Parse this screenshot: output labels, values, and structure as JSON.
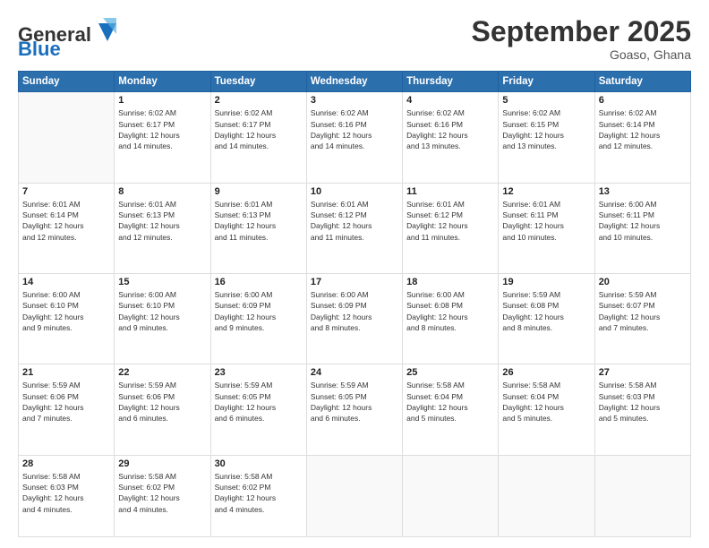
{
  "header": {
    "logo_general": "General",
    "logo_blue": "Blue",
    "month_title": "September 2025",
    "subtitle": "Goaso, Ghana"
  },
  "days_of_week": [
    "Sunday",
    "Monday",
    "Tuesday",
    "Wednesday",
    "Thursday",
    "Friday",
    "Saturday"
  ],
  "weeks": [
    [
      {
        "day": "",
        "info": ""
      },
      {
        "day": "1",
        "info": "Sunrise: 6:02 AM\nSunset: 6:17 PM\nDaylight: 12 hours\nand 14 minutes."
      },
      {
        "day": "2",
        "info": "Sunrise: 6:02 AM\nSunset: 6:17 PM\nDaylight: 12 hours\nand 14 minutes."
      },
      {
        "day": "3",
        "info": "Sunrise: 6:02 AM\nSunset: 6:16 PM\nDaylight: 12 hours\nand 14 minutes."
      },
      {
        "day": "4",
        "info": "Sunrise: 6:02 AM\nSunset: 6:16 PM\nDaylight: 12 hours\nand 13 minutes."
      },
      {
        "day": "5",
        "info": "Sunrise: 6:02 AM\nSunset: 6:15 PM\nDaylight: 12 hours\nand 13 minutes."
      },
      {
        "day": "6",
        "info": "Sunrise: 6:02 AM\nSunset: 6:14 PM\nDaylight: 12 hours\nand 12 minutes."
      }
    ],
    [
      {
        "day": "7",
        "info": "Sunrise: 6:01 AM\nSunset: 6:14 PM\nDaylight: 12 hours\nand 12 minutes."
      },
      {
        "day": "8",
        "info": "Sunrise: 6:01 AM\nSunset: 6:13 PM\nDaylight: 12 hours\nand 12 minutes."
      },
      {
        "day": "9",
        "info": "Sunrise: 6:01 AM\nSunset: 6:13 PM\nDaylight: 12 hours\nand 11 minutes."
      },
      {
        "day": "10",
        "info": "Sunrise: 6:01 AM\nSunset: 6:12 PM\nDaylight: 12 hours\nand 11 minutes."
      },
      {
        "day": "11",
        "info": "Sunrise: 6:01 AM\nSunset: 6:12 PM\nDaylight: 12 hours\nand 11 minutes."
      },
      {
        "day": "12",
        "info": "Sunrise: 6:01 AM\nSunset: 6:11 PM\nDaylight: 12 hours\nand 10 minutes."
      },
      {
        "day": "13",
        "info": "Sunrise: 6:00 AM\nSunset: 6:11 PM\nDaylight: 12 hours\nand 10 minutes."
      }
    ],
    [
      {
        "day": "14",
        "info": "Sunrise: 6:00 AM\nSunset: 6:10 PM\nDaylight: 12 hours\nand 9 minutes."
      },
      {
        "day": "15",
        "info": "Sunrise: 6:00 AM\nSunset: 6:10 PM\nDaylight: 12 hours\nand 9 minutes."
      },
      {
        "day": "16",
        "info": "Sunrise: 6:00 AM\nSunset: 6:09 PM\nDaylight: 12 hours\nand 9 minutes."
      },
      {
        "day": "17",
        "info": "Sunrise: 6:00 AM\nSunset: 6:09 PM\nDaylight: 12 hours\nand 8 minutes."
      },
      {
        "day": "18",
        "info": "Sunrise: 6:00 AM\nSunset: 6:08 PM\nDaylight: 12 hours\nand 8 minutes."
      },
      {
        "day": "19",
        "info": "Sunrise: 5:59 AM\nSunset: 6:08 PM\nDaylight: 12 hours\nand 8 minutes."
      },
      {
        "day": "20",
        "info": "Sunrise: 5:59 AM\nSunset: 6:07 PM\nDaylight: 12 hours\nand 7 minutes."
      }
    ],
    [
      {
        "day": "21",
        "info": "Sunrise: 5:59 AM\nSunset: 6:06 PM\nDaylight: 12 hours\nand 7 minutes."
      },
      {
        "day": "22",
        "info": "Sunrise: 5:59 AM\nSunset: 6:06 PM\nDaylight: 12 hours\nand 6 minutes."
      },
      {
        "day": "23",
        "info": "Sunrise: 5:59 AM\nSunset: 6:05 PM\nDaylight: 12 hours\nand 6 minutes."
      },
      {
        "day": "24",
        "info": "Sunrise: 5:59 AM\nSunset: 6:05 PM\nDaylight: 12 hours\nand 6 minutes."
      },
      {
        "day": "25",
        "info": "Sunrise: 5:58 AM\nSunset: 6:04 PM\nDaylight: 12 hours\nand 5 minutes."
      },
      {
        "day": "26",
        "info": "Sunrise: 5:58 AM\nSunset: 6:04 PM\nDaylight: 12 hours\nand 5 minutes."
      },
      {
        "day": "27",
        "info": "Sunrise: 5:58 AM\nSunset: 6:03 PM\nDaylight: 12 hours\nand 5 minutes."
      }
    ],
    [
      {
        "day": "28",
        "info": "Sunrise: 5:58 AM\nSunset: 6:03 PM\nDaylight: 12 hours\nand 4 minutes."
      },
      {
        "day": "29",
        "info": "Sunrise: 5:58 AM\nSunset: 6:02 PM\nDaylight: 12 hours\nand 4 minutes."
      },
      {
        "day": "30",
        "info": "Sunrise: 5:58 AM\nSunset: 6:02 PM\nDaylight: 12 hours\nand 4 minutes."
      },
      {
        "day": "",
        "info": ""
      },
      {
        "day": "",
        "info": ""
      },
      {
        "day": "",
        "info": ""
      },
      {
        "day": "",
        "info": ""
      }
    ]
  ]
}
